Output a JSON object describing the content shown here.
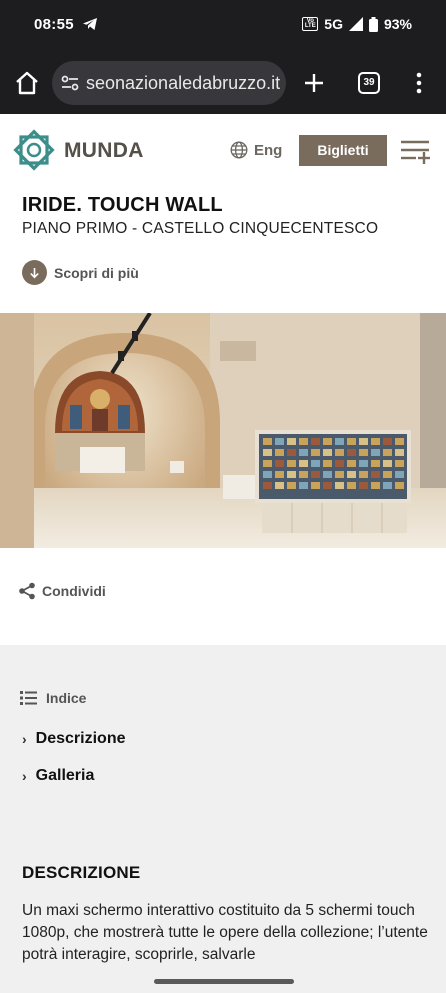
{
  "status_bar": {
    "time": "08:55",
    "network": "5G",
    "battery": "93%"
  },
  "browser": {
    "url": "seonazionaledabruzzo.it",
    "tab_count": "39"
  },
  "header": {
    "logo_text": "MUNDA",
    "language": "Eng",
    "tickets_label": "Biglietti"
  },
  "page": {
    "title": "IRIDE. TOUCH WALL",
    "subtitle": "PIANO PRIMO - CASTELLO CINQUECENTESCO",
    "discover_label": "Scopri di più",
    "share_label": "Condividi"
  },
  "index": {
    "heading": "Indice",
    "items": [
      "Descrizione",
      "Galleria"
    ]
  },
  "description": {
    "heading": "DESCRIZIONE",
    "body": "Un maxi schermo interattivo costituito da 5 schermi touch 1080p, che mostrerà tutte le opere della collezione; l’utente potrà interagire, scoprirle, salvarle"
  },
  "colors": {
    "brand_brown": "#7a6c5d",
    "logo_teal": "#3d8e8a",
    "status_bar": "#1d1d20"
  }
}
